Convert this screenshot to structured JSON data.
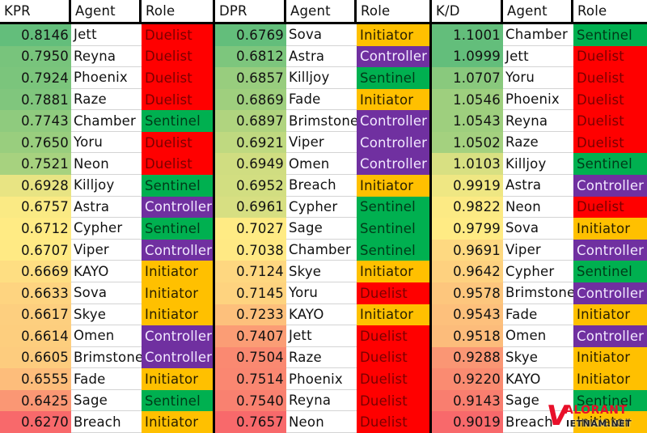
{
  "scale_colors": {
    "high": "#63BE7B",
    "mid": "#FFEB84",
    "low": "#F8696B"
  },
  "role_colors": {
    "Duelist": "#FF0000",
    "Initiator": "#FFC000",
    "Sentinel": "#00B050",
    "Controller": "#7030A0"
  },
  "tables": [
    {
      "headers": [
        "KPR",
        "Agent",
        "Role"
      ],
      "scale_direction": "higher-is-better",
      "rows": [
        {
          "value": "0.8146",
          "agent": "Jett",
          "role": "Duelist"
        },
        {
          "value": "0.7950",
          "agent": "Reyna",
          "role": "Duelist"
        },
        {
          "value": "0.7924",
          "agent": "Phoenix",
          "role": "Duelist"
        },
        {
          "value": "0.7881",
          "agent": "Raze",
          "role": "Duelist"
        },
        {
          "value": "0.7743",
          "agent": "Chamber",
          "role": "Sentinel"
        },
        {
          "value": "0.7650",
          "agent": "Yoru",
          "role": "Duelist"
        },
        {
          "value": "0.7521",
          "agent": "Neon",
          "role": "Duelist"
        },
        {
          "value": "0.6928",
          "agent": "Killjoy",
          "role": "Sentinel"
        },
        {
          "value": "0.6757",
          "agent": "Astra",
          "role": "Controller"
        },
        {
          "value": "0.6712",
          "agent": "Cypher",
          "role": "Sentinel"
        },
        {
          "value": "0.6707",
          "agent": "Viper",
          "role": "Controller"
        },
        {
          "value": "0.6669",
          "agent": "KAYO",
          "role": "Initiator"
        },
        {
          "value": "0.6633",
          "agent": "Sova",
          "role": "Initiator"
        },
        {
          "value": "0.6617",
          "agent": "Skye",
          "role": "Initiator"
        },
        {
          "value": "0.6614",
          "agent": "Omen",
          "role": "Controller"
        },
        {
          "value": "0.6605",
          "agent": "Brimstone",
          "role": "Controller"
        },
        {
          "value": "0.6555",
          "agent": "Fade",
          "role": "Initiator"
        },
        {
          "value": "0.6425",
          "agent": "Sage",
          "role": "Sentinel"
        },
        {
          "value": "0.6270",
          "agent": "Breach",
          "role": "Initiator"
        }
      ]
    },
    {
      "headers": [
        "DPR",
        "Agent",
        "Role"
      ],
      "scale_direction": "lower-is-better",
      "rows": [
        {
          "value": "0.6769",
          "agent": "Sova",
          "role": "Initiator"
        },
        {
          "value": "0.6812",
          "agent": "Astra",
          "role": "Controller"
        },
        {
          "value": "0.6857",
          "agent": "Killjoy",
          "role": "Sentinel"
        },
        {
          "value": "0.6869",
          "agent": "Fade",
          "role": "Initiator"
        },
        {
          "value": "0.6897",
          "agent": "Brimstone",
          "role": "Controller"
        },
        {
          "value": "0.6921",
          "agent": "Viper",
          "role": "Controller"
        },
        {
          "value": "0.6949",
          "agent": "Omen",
          "role": "Controller"
        },
        {
          "value": "0.6952",
          "agent": "Breach",
          "role": "Initiator"
        },
        {
          "value": "0.6961",
          "agent": "Cypher",
          "role": "Sentinel"
        },
        {
          "value": "0.7027",
          "agent": "Sage",
          "role": "Sentinel"
        },
        {
          "value": "0.7038",
          "agent": "Chamber",
          "role": "Sentinel"
        },
        {
          "value": "0.7124",
          "agent": "Skye",
          "role": "Initiator"
        },
        {
          "value": "0.7145",
          "agent": "Yoru",
          "role": "Duelist"
        },
        {
          "value": "0.7233",
          "agent": "KAYO",
          "role": "Initiator"
        },
        {
          "value": "0.7407",
          "agent": "Jett",
          "role": "Duelist"
        },
        {
          "value": "0.7504",
          "agent": "Raze",
          "role": "Duelist"
        },
        {
          "value": "0.7514",
          "agent": "Phoenix",
          "role": "Duelist"
        },
        {
          "value": "0.7540",
          "agent": "Reyna",
          "role": "Duelist"
        },
        {
          "value": "0.7657",
          "agent": "Neon",
          "role": "Duelist"
        }
      ]
    },
    {
      "headers": [
        "K/D",
        "Agent",
        "Role"
      ],
      "scale_direction": "higher-is-better",
      "rows": [
        {
          "value": "1.1001",
          "agent": "Chamber",
          "role": "Sentinel"
        },
        {
          "value": "1.0999",
          "agent": "Jett",
          "role": "Duelist"
        },
        {
          "value": "1.0707",
          "agent": "Yoru",
          "role": "Duelist"
        },
        {
          "value": "1.0546",
          "agent": "Phoenix",
          "role": "Duelist"
        },
        {
          "value": "1.0543",
          "agent": "Reyna",
          "role": "Duelist"
        },
        {
          "value": "1.0502",
          "agent": "Raze",
          "role": "Duelist"
        },
        {
          "value": "1.0103",
          "agent": "Killjoy",
          "role": "Sentinel"
        },
        {
          "value": "0.9919",
          "agent": "Astra",
          "role": "Controller"
        },
        {
          "value": "0.9822",
          "agent": "Neon",
          "role": "Duelist"
        },
        {
          "value": "0.9799",
          "agent": "Sova",
          "role": "Initiator"
        },
        {
          "value": "0.9691",
          "agent": "Viper",
          "role": "Controller"
        },
        {
          "value": "0.9642",
          "agent": "Cypher",
          "role": "Sentinel"
        },
        {
          "value": "0.9578",
          "agent": "Brimstone",
          "role": "Controller"
        },
        {
          "value": "0.9543",
          "agent": "Fade",
          "role": "Initiator"
        },
        {
          "value": "0.9518",
          "agent": "Omen",
          "role": "Controller"
        },
        {
          "value": "0.9288",
          "agent": "Skye",
          "role": "Initiator"
        },
        {
          "value": "0.9220",
          "agent": "KAYO",
          "role": "Initiator"
        },
        {
          "value": "0.9143",
          "agent": "Sage",
          "role": "Sentinel"
        },
        {
          "value": "0.9019",
          "agent": "Breach",
          "role": "Initiator"
        }
      ]
    }
  ],
  "watermark": {
    "logo_initial": "V",
    "top_text": "ALORANT",
    "bottom_text": "IETNAM.NET"
  }
}
